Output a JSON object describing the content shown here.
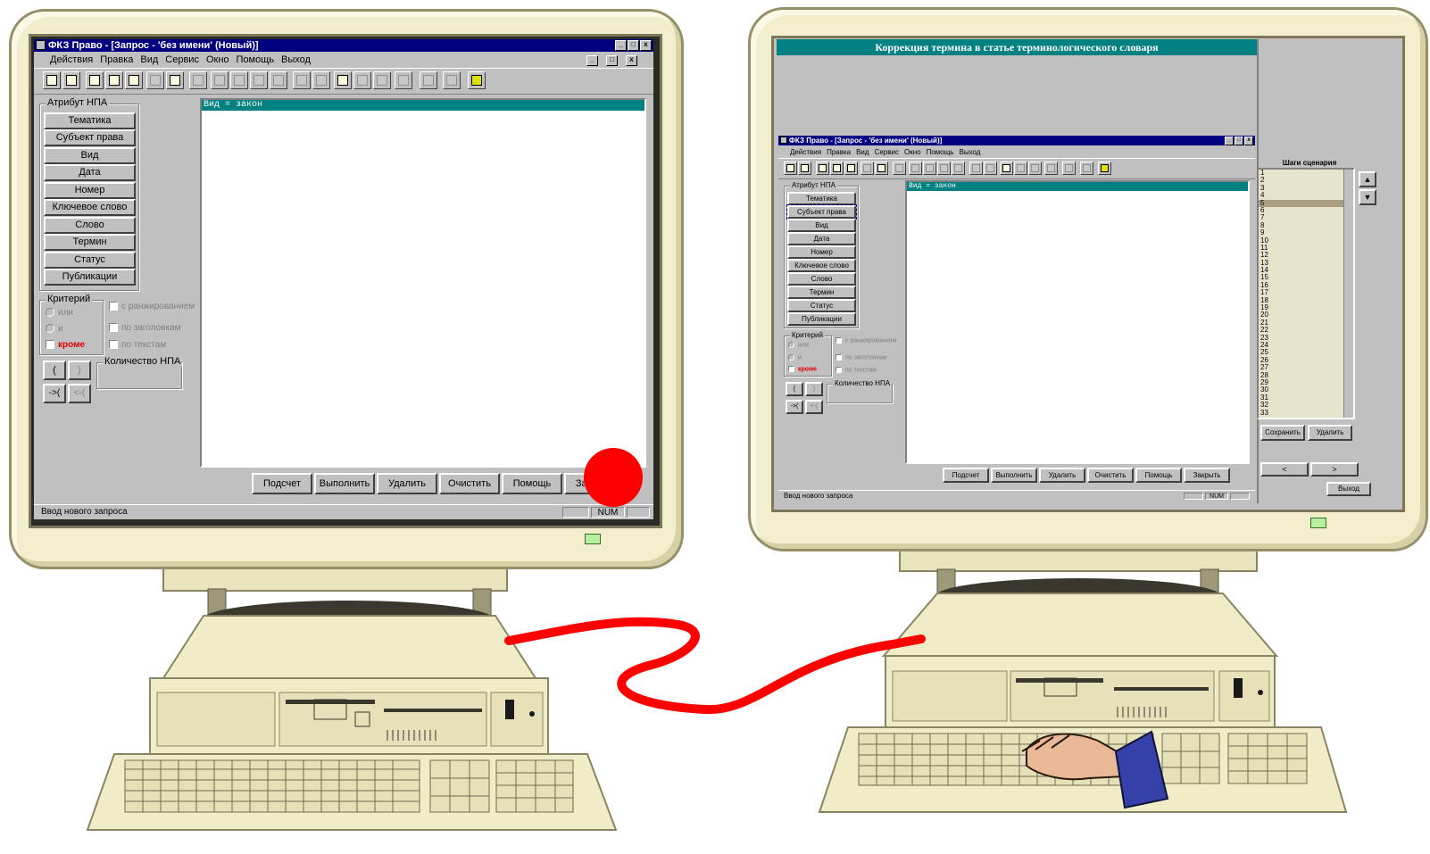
{
  "left_monitor": {
    "window": {
      "title": "ФКЗ Право - [Запрос - 'без имени' (Новый)]",
      "menu": [
        "Действия",
        "Правка",
        "Вид",
        "Сервис",
        "Окно",
        "Помощь",
        "Выход"
      ],
      "attr_group_label": "Атрибут НПА",
      "attr_buttons": [
        "Тематика",
        "Субъект права",
        "Вид",
        "Дата",
        "Номер",
        "Ключевое слово",
        "Слово",
        "Термин",
        "Статус",
        "Публикации"
      ],
      "criteria_label": "Критерий",
      "criteria": {
        "or": "или",
        "and": "и",
        "except": "кроме"
      },
      "options": [
        "с ранжированием",
        "по заголовкам",
        "по текстам"
      ],
      "paren_open": "(",
      "paren_close": ")",
      "btn_in": "->(",
      "btn_out": "<-(",
      "count_label": "Количество НПА",
      "query_line": "Вид = закон",
      "bottom_buttons": [
        "Подсчет",
        "Выполнить",
        "Удалить",
        "Очистить",
        "Помощь",
        "Закрыть"
      ],
      "status_text": "Ввод нового запроса",
      "status_num": "NUM"
    },
    "marker_color": "#ff0000"
  },
  "right_monitor": {
    "header_title": "Коррекция термина в статье терминологического словаря",
    "window": {
      "title": "ФКЗ Право - [Запрос - 'без имени' (Новый)]",
      "menu": [
        "Действия",
        "Правка",
        "Вид",
        "Сервис",
        "Окно",
        "Помощь",
        "Выход"
      ],
      "attr_group_label": "Атрибут НПА",
      "attr_buttons": [
        "Тематика",
        "Субъект права",
        "Вид",
        "Дата",
        "Номер",
        "Ключевое слово",
        "Слово",
        "Термин",
        "Статус",
        "Публикации"
      ],
      "criteria_label": "Критерий",
      "criteria": {
        "or": "или",
        "and": "и",
        "except": "кроме"
      },
      "options": [
        "с ранжированием",
        "по заголовкам",
        "по текстам"
      ],
      "paren_open": "(",
      "paren_close": ")",
      "btn_in": "->(",
      "btn_out": "<-(",
      "count_label": "Количество НПА",
      "query_line": "Вид = закон",
      "bottom_buttons": [
        "Подсчет",
        "Выполнить",
        "Удалить",
        "Очистить",
        "Помощь",
        "Закрыть"
      ],
      "status_text": "Ввод нового запроса",
      "status_num": "NUM"
    },
    "steps_title": "Шаги сценария",
    "steps": [
      "1",
      "2",
      "3",
      "4",
      "5",
      "6",
      "7",
      "8",
      "9",
      "10",
      "11",
      "12",
      "13",
      "14",
      "15",
      "16",
      "17",
      "18",
      "19",
      "20",
      "21",
      "22",
      "23",
      "24",
      "25",
      "26",
      "27",
      "28",
      "29",
      "30",
      "31",
      "32",
      "33"
    ],
    "selected_step": 5,
    "save_button": "Сохранить",
    "delete_button": "Удалить",
    "prev_button": "<",
    "next_button": ">",
    "exit_button": "Выход"
  },
  "cable_color": "#ff0000"
}
